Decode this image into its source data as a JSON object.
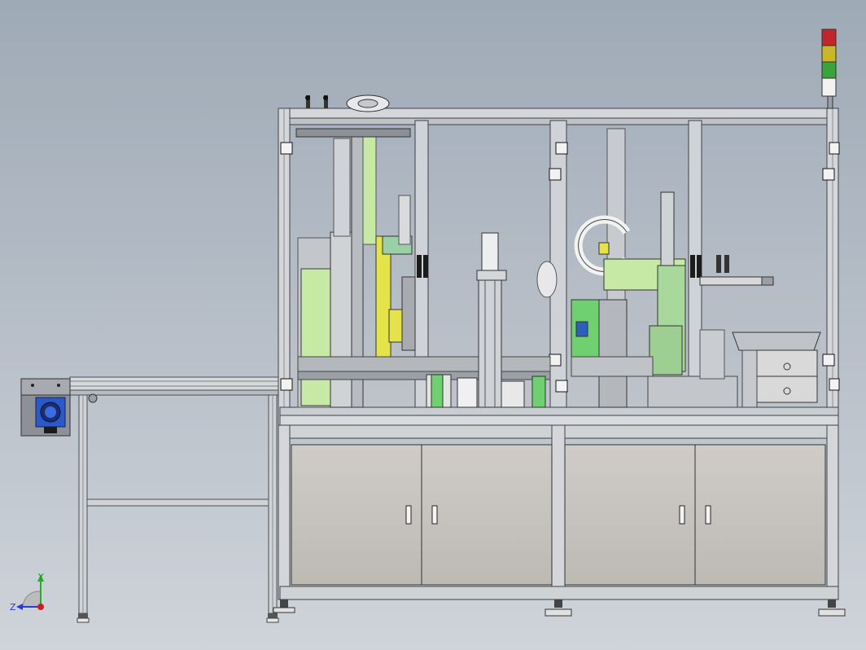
{
  "viewport": {
    "background_top": "#9eaab6",
    "background_bottom": "#cfd4da"
  },
  "model": {
    "frame_color": "#c9ccd0",
    "cabinet_color": "#c8c5c0",
    "accent_green": "#c6eaa6",
    "accent_yellow": "#e4e34a",
    "glass_color": "#b9c0c7"
  },
  "signal_tower": {
    "lights": [
      "#c0262b",
      "#c9b629",
      "#3aa33a",
      "#f2f2f2"
    ]
  },
  "cabinet": {
    "door_count": 4,
    "handle_icon": "door-handle-icon"
  },
  "triad": {
    "y_label": "Y",
    "z_label": "Z",
    "icon": "coordinate-triad-icon"
  }
}
